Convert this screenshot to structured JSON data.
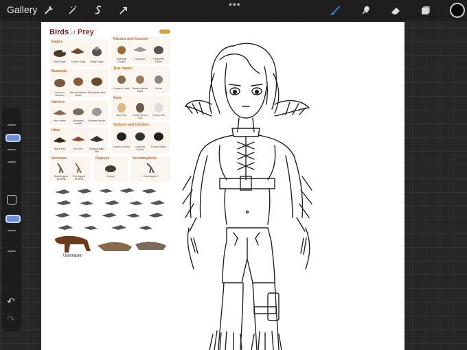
{
  "app": {
    "gallery_label": "Gallery",
    "toolbar_dots": "•••",
    "tools": [
      "wrench-icon",
      "magic-wand-icon",
      "selection-icon",
      "transform-arrow-icon"
    ],
    "right_tools": [
      "brush-icon",
      "smudge-icon",
      "eraser-icon",
      "layers-icon"
    ],
    "current_color": "#000000",
    "accent": "#3d7fe0"
  },
  "sidebar": {
    "undo_label": "↶",
    "redo_label": "↷"
  },
  "reference": {
    "title_a": "Birds",
    "title_of": "of",
    "title_b": "Prey",
    "groups": [
      {
        "label": "Eagles",
        "birds": [
          "Bald Eagle",
          "Golden Eagle",
          "Harpy Eagle"
        ]
      },
      {
        "label": "Falcons and Kestrels",
        "birds": [
          "American Kestrel",
          "Gyrfalcon",
          "Peregrine Falcon"
        ]
      },
      {
        "label": "Buzzards",
        "birds": [
          "Common Buzzard",
          "Red-shouldered Hawk",
          "Red-tailed Hawk"
        ]
      },
      {
        "label": "True Hawks",
        "birds": [
          "Cooper's Hawk",
          "Sharp-shinned Hawk",
          "Shikra"
        ]
      },
      {
        "label": "Harriers",
        "birds": [
          "Hen Harrier",
          "Montagu's Harrier",
          "Northern Harrier"
        ]
      },
      {
        "label": "Owls",
        "birds": [
          "Barn Owl",
          "Great Horned Owl",
          "Snowy Owl"
        ]
      },
      {
        "label": "Kites",
        "birds": [
          "Black Kite",
          "Red Kite",
          "Swallow-tailed Kite"
        ]
      },
      {
        "label": "Vultures and Condors",
        "birds": [
          "Andean Condor",
          "California Condor",
          "Turkey Vulture"
        ]
      },
      {
        "label": "Seriemas",
        "birds": [
          "Black-legged Seriema",
          "Red-legged Seriema"
        ]
      },
      {
        "label": "Ospreys",
        "birds": [
          "Osprey"
        ]
      },
      {
        "label": "Secretarybirds",
        "birds": [
          "Secretarybird"
        ]
      }
    ],
    "dino_label": "Utahraptor"
  }
}
